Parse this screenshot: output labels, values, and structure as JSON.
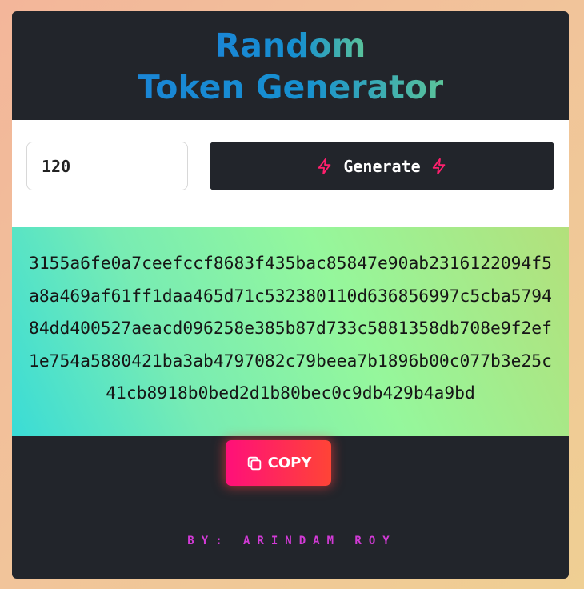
{
  "header": {
    "title_line1": "Random",
    "title_line2": "Token Generator"
  },
  "controls": {
    "length_value": "120",
    "generate_label": "Generate",
    "icons": [
      "lightning-bolt-icon",
      "lightning-bolt-icon"
    ]
  },
  "token": {
    "value": "3155a6fe0a7ceefccf8683f435bac85847e90ab2316122094f5a8a469af61ff1daa465d71c532380110d636856997c5cba579484dd400527aeacd096258e385b87d733c5881358db708e9f2ef1e754a5880421ba3ab4797082c79beea7b1896b00c077b3e25c41cb8918b0bed2d1b80bec0c9db429b4a9bd"
  },
  "actions": {
    "copy_label": "COPY",
    "copy_icon": "copy-icon"
  },
  "footer": {
    "credit": "BY: ARINDAM ROY"
  },
  "colors": {
    "card": "#22252b",
    "accent_pink": "#ff0f7a",
    "accent_orange": "#ff4436",
    "credit": "#d23ad6"
  }
}
